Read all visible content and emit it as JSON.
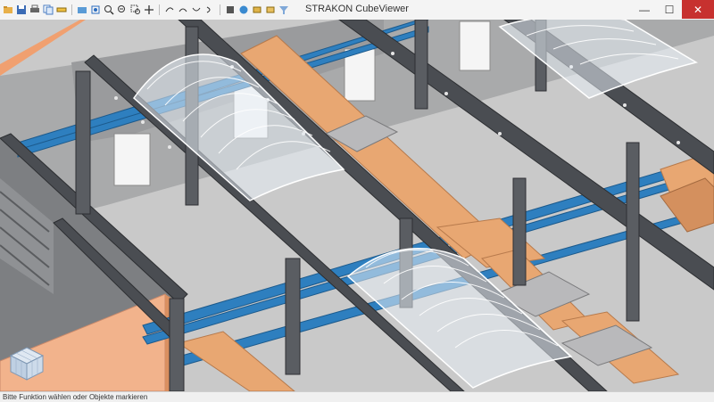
{
  "window": {
    "title": "STRAKON CubeViewer",
    "controls": {
      "minimize": "—",
      "maximize": "☐",
      "close": "✕"
    }
  },
  "toolbar": {
    "icons": [
      "open-icon",
      "save-icon",
      "print-icon",
      "copy-icon",
      "measure-icon",
      "folder-icon",
      "fit-view-icon",
      "zoom-in-icon",
      "zoom-out-icon",
      "zoom-window-icon",
      "pan-icon",
      "rotate-icon",
      "rotate-x-icon",
      "rotate-y-icon",
      "rotate-z-icon",
      "view-icon",
      "color-icon",
      "layer-icon",
      "layer-2-icon",
      "filter-icon"
    ]
  },
  "statusbar": {
    "text": "Bitte Funktion wählen oder Objekte markieren"
  },
  "colors": {
    "steel": "#4a4d52",
    "steel_light": "#8f939a",
    "blue_duct": "#2e7fbf",
    "timber": "#e8a772",
    "orange_wall": "#f2b38c",
    "floor": "#c8c8c8",
    "skylight": "#e6ecf4",
    "window_bar_close": "#c7312f"
  }
}
